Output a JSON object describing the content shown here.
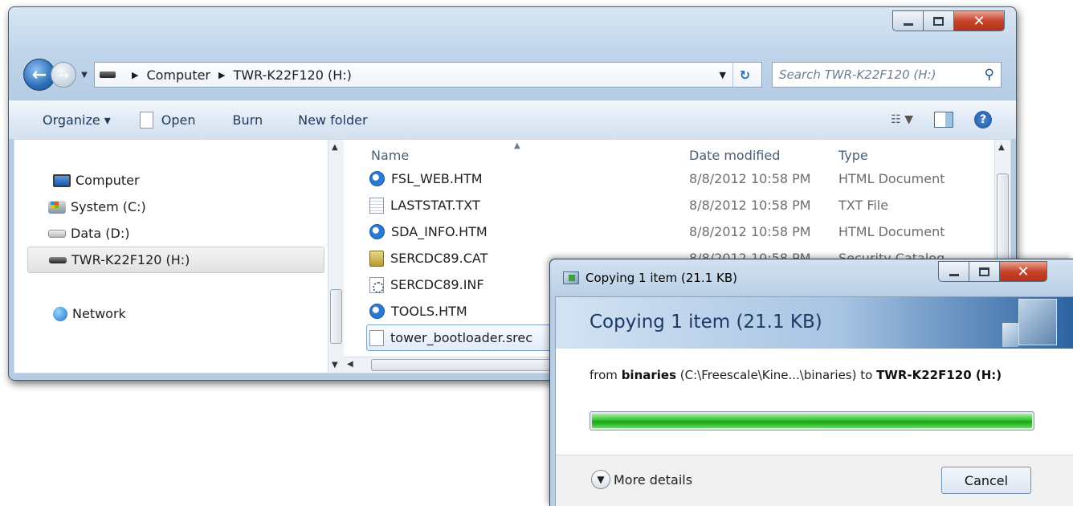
{
  "explorer": {
    "address": {
      "crumbs": [
        "Computer",
        "TWR-K22F120 (H:)"
      ]
    },
    "search": {
      "placeholder": "Search TWR-K22F120 (H:)"
    },
    "toolbar": {
      "organize": "Organize ▾",
      "open": "Open",
      "burn": "Burn",
      "new_folder": "New folder"
    },
    "nav": {
      "items": [
        {
          "label": "Computer",
          "icon": "computer-icon"
        },
        {
          "label": "System (C:)",
          "icon": "system-drive-icon"
        },
        {
          "label": "Data (D:)",
          "icon": "data-drive-icon"
        },
        {
          "label": "TWR-K22F120 (H:)",
          "icon": "removable-drive-icon",
          "selected": true
        },
        {
          "label": "Network",
          "icon": "network-icon"
        }
      ]
    },
    "columns": {
      "name": "Name",
      "date": "Date modified",
      "type": "Type"
    },
    "files": [
      {
        "name": "FSL_WEB.HTM",
        "date": "8/8/2012 10:58 PM",
        "type": "HTML Document",
        "icon": "html-file-icon"
      },
      {
        "name": "LASTSTAT.TXT",
        "date": "8/8/2012 10:58 PM",
        "type": "TXT File",
        "icon": "text-file-icon"
      },
      {
        "name": "SDA_INFO.HTM",
        "date": "8/8/2012 10:58 PM",
        "type": "HTML Document",
        "icon": "html-file-icon"
      },
      {
        "name": "SERCDC89.CAT",
        "date": "8/8/2012 10:58 PM",
        "type": "Security Catalog",
        "icon": "catalog-file-icon"
      },
      {
        "name": "SERCDC89.INF",
        "date": "",
        "type": "",
        "icon": "inf-file-icon"
      },
      {
        "name": "TOOLS.HTM",
        "date": "",
        "type": "",
        "icon": "html-file-icon"
      },
      {
        "name": "tower_bootloader.srec",
        "date": "",
        "type": "",
        "icon": "generic-file-icon",
        "selected": true
      }
    ]
  },
  "copy_dialog": {
    "title": "Copying 1 item (21.1 KB)",
    "heading": "Copying 1 item (21.1 KB)",
    "from_prefix": "from ",
    "from_folder": "binaries",
    "from_path": " (C:\\Freescale\\Kine...\\binaries) to ",
    "to_target": "TWR-K22F120 (H:)",
    "progress": 1.0,
    "more_details": "More details",
    "cancel": "Cancel"
  }
}
